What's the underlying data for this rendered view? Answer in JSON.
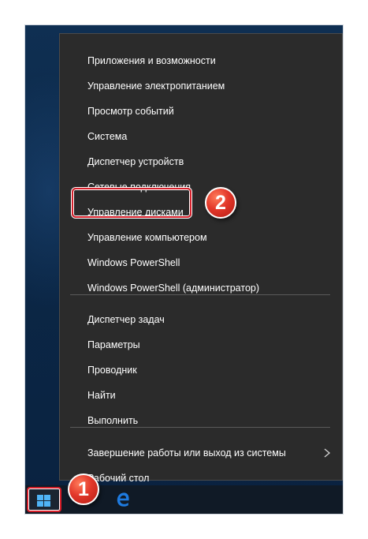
{
  "menu": {
    "group1": [
      "Приложения и возможности",
      "Управление электропитанием",
      "Просмотр событий",
      "Система",
      "Диспетчер устройств",
      "Сетевые подключения",
      "Управление дисками",
      "Управление компьютером",
      "Windows PowerShell",
      "Windows PowerShell (администратор)"
    ],
    "group2": [
      "Диспетчер задач",
      "Параметры",
      "Проводник",
      "Найти",
      "Выполнить"
    ],
    "group3": [
      "Завершение работы или выход из системы",
      "Рабочий стол"
    ]
  },
  "annotations": {
    "step1": "1",
    "step2": "2"
  },
  "taskbar": {
    "start_icon": "windows-logo-icon",
    "pinned_icon": "edge-browser-icon"
  },
  "colors": {
    "menu_bg": "#2b2b2b",
    "highlight": "#d61f2a",
    "badge": "#e2372a",
    "edge_blue": "#1e7be0"
  }
}
